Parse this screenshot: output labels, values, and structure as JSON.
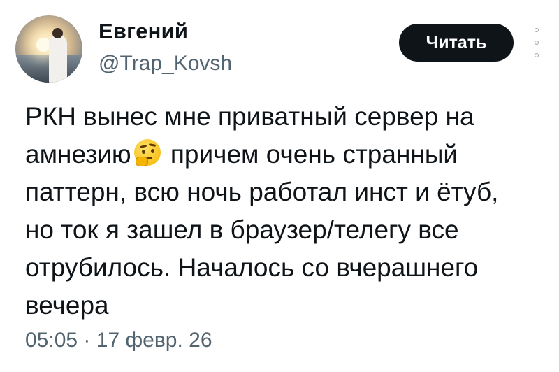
{
  "author": {
    "name": "Евгений",
    "handle": "@Trap_Kovsh"
  },
  "actions": {
    "follow_label": "Читать",
    "more_icon": "more-vertical-icon"
  },
  "post": {
    "lines": [
      "РКН вынес мне приватный сервер на",
      "амнезию",
      " причем очень странный",
      "паттерн, всю ночь работал инст и ётуб,",
      "но ток я зашел в браузер/телегу все",
      "отрубилось. Началось со вчерашнего",
      "вечера"
    ],
    "emoji": "thinking-face-emoji"
  },
  "meta": {
    "time": "05:05",
    "separator": "·",
    "date": "17 февр. 26"
  },
  "colors": {
    "text": "#0f1419",
    "secondary": "#536471",
    "button_bg": "#0f1419",
    "button_text": "#ffffff"
  }
}
